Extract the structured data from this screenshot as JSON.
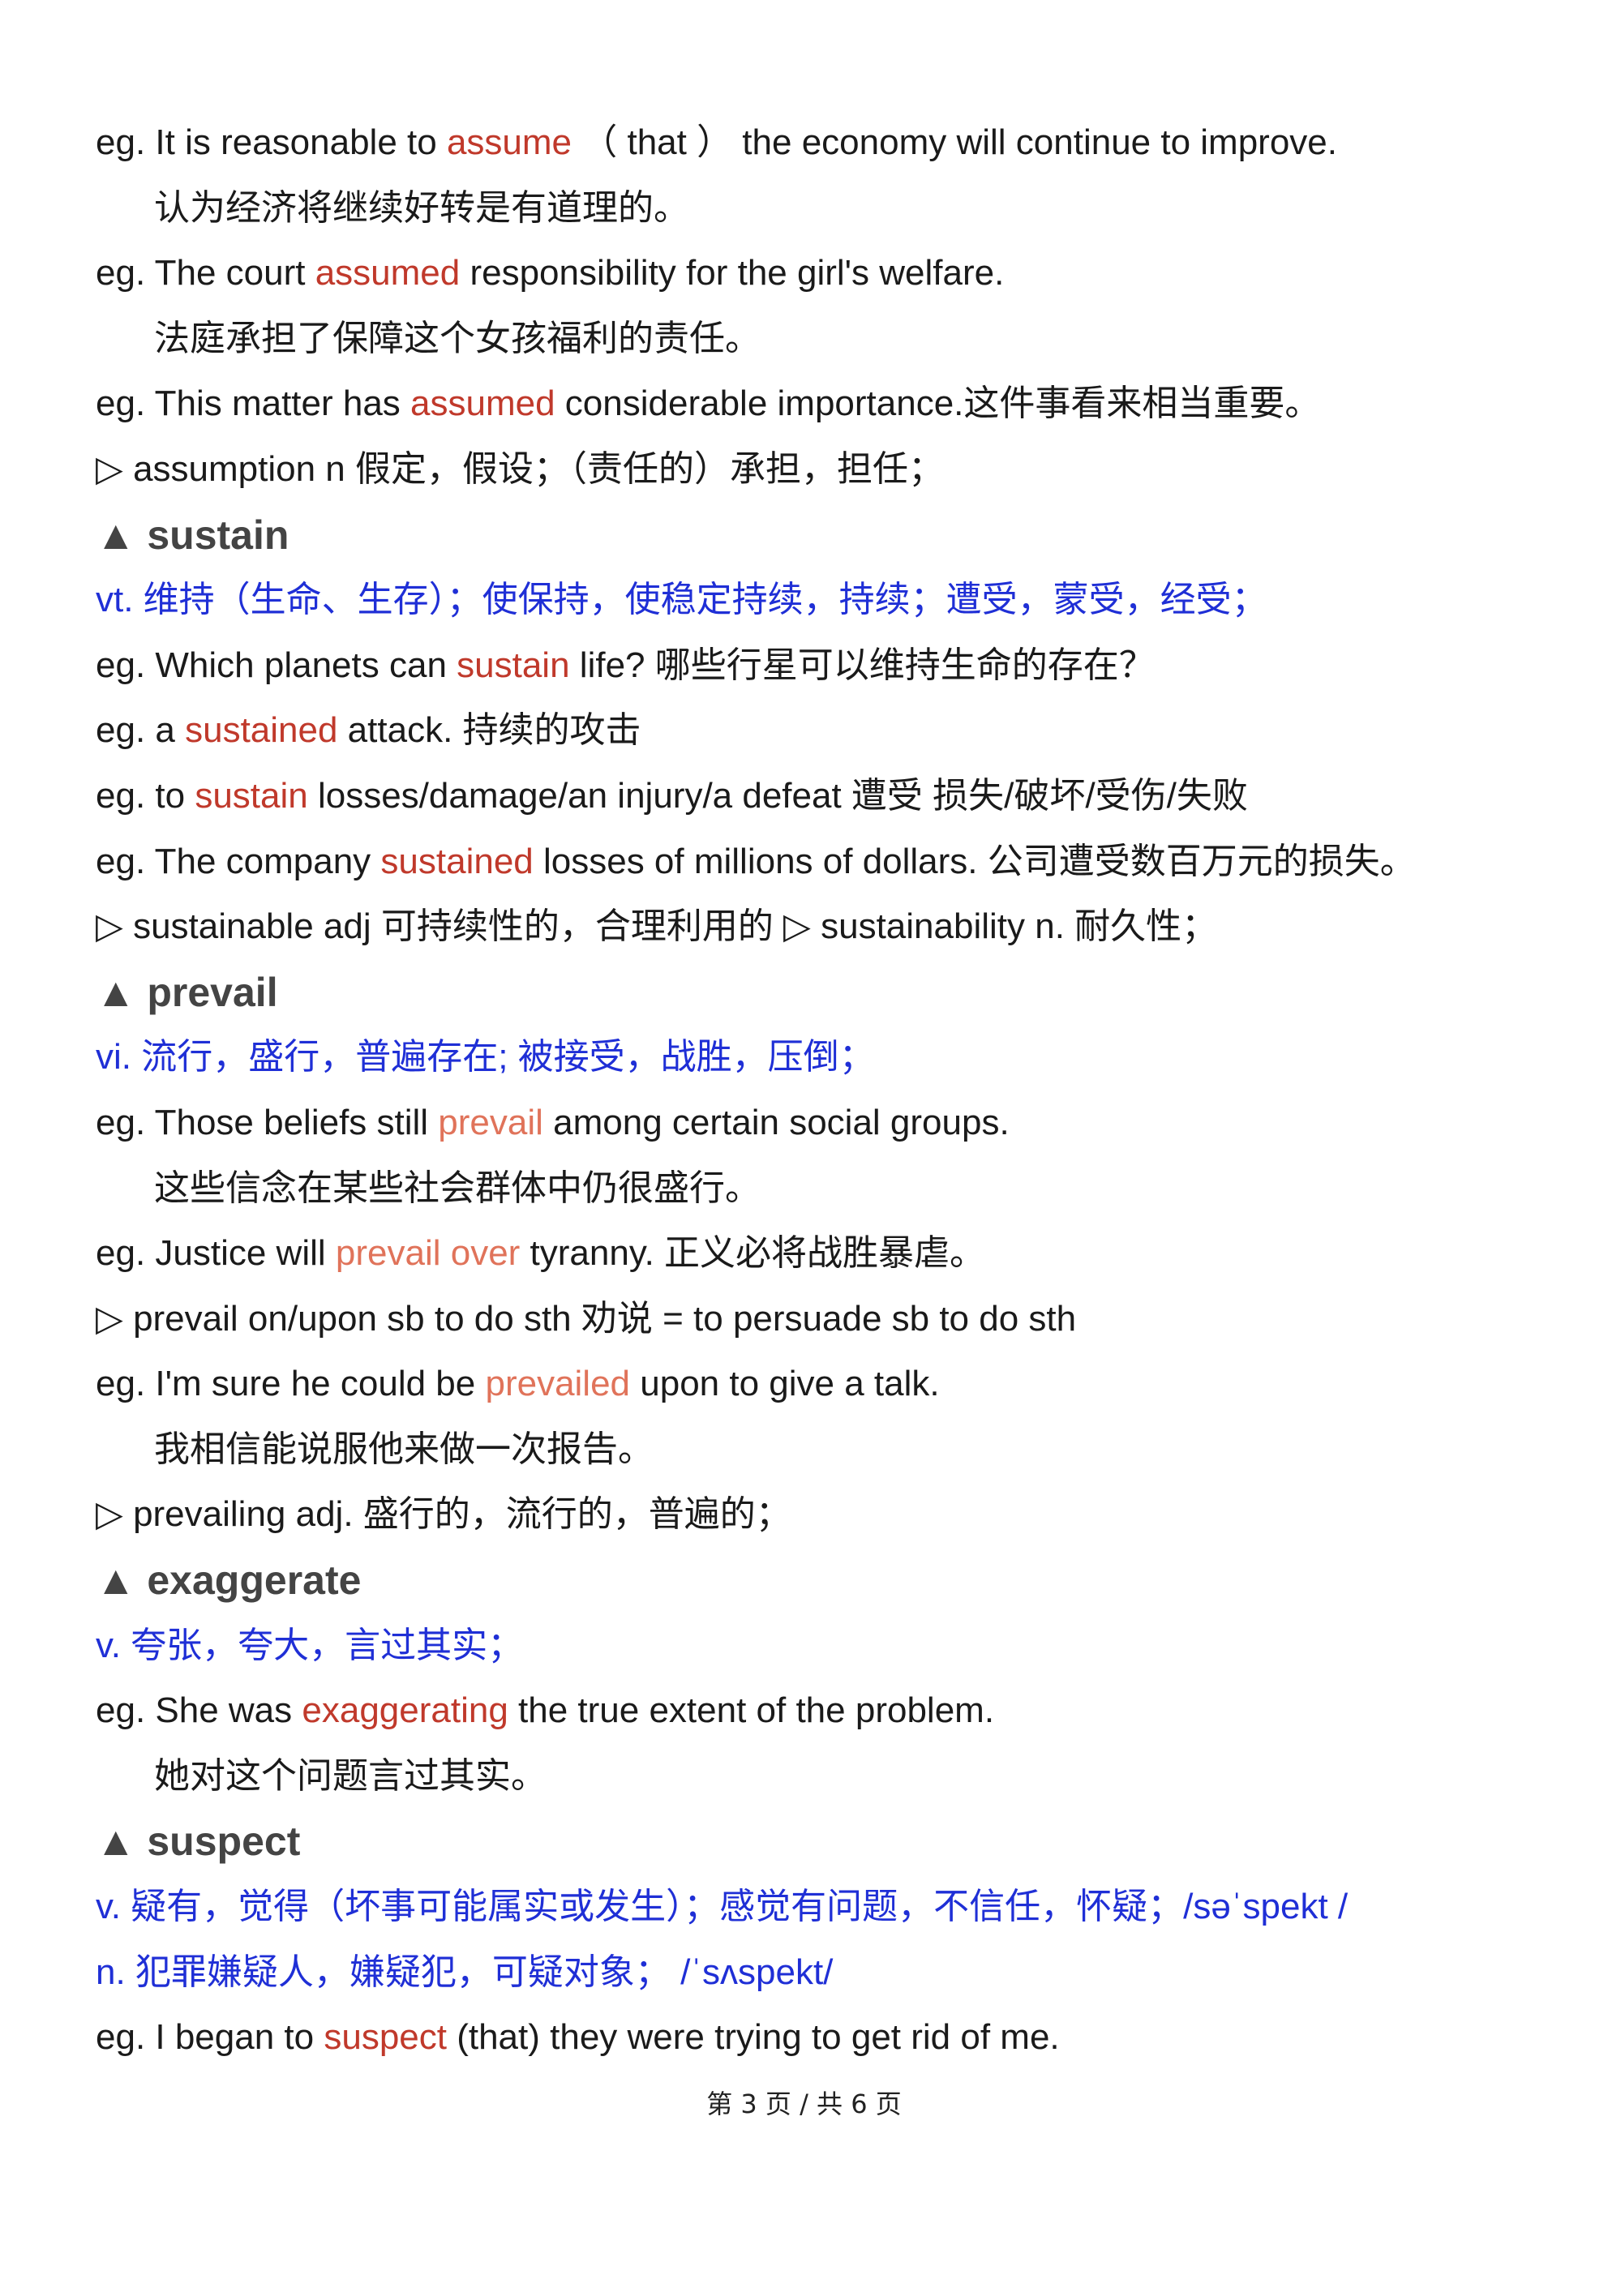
{
  "lines": [
    {
      "type": "example",
      "parts": [
        {
          "t": "eg. It is reasonable to "
        },
        {
          "t": "assume",
          "c": "hl"
        },
        {
          "t": "  （ that ）  the economy will continue to improve."
        }
      ]
    },
    {
      "type": "translation",
      "parts": [
        {
          "t": "认为经济将继续好转是有道理的。"
        }
      ]
    },
    {
      "type": "example",
      "parts": [
        {
          "t": "eg. The court "
        },
        {
          "t": "assumed",
          "c": "hl"
        },
        {
          "t": " responsibility for the girl's welfare."
        }
      ]
    },
    {
      "type": "translation",
      "parts": [
        {
          "t": "法庭承担了保障这个女孩福利的责任。"
        }
      ]
    },
    {
      "type": "example",
      "parts": [
        {
          "t": "eg. This matter has "
        },
        {
          "t": "assumed",
          "c": "hl"
        },
        {
          "t": " considerable importance.这件事看来相当重要。"
        }
      ]
    },
    {
      "type": "derivative",
      "parts": [
        {
          "t": "▷ assumption n  假定，假设；（责任的）承担，担任；"
        }
      ]
    },
    {
      "type": "headword",
      "parts": [
        {
          "t": "▲ sustain"
        }
      ]
    },
    {
      "type": "definition",
      "parts": [
        {
          "t": "vt.  维持（生命、生存）；使保持，使稳定持续，持续；遭受，蒙受，经受；"
        }
      ]
    },
    {
      "type": "example",
      "parts": [
        {
          "t": "eg. Which planets can "
        },
        {
          "t": "sustain",
          "c": "hl"
        },
        {
          "t": " life?  哪些行星可以维持生命的存在？"
        }
      ]
    },
    {
      "type": "example",
      "parts": [
        {
          "t": "eg. a "
        },
        {
          "t": "sustained",
          "c": "hl"
        },
        {
          "t": " attack.  持续的攻击"
        }
      ]
    },
    {
      "type": "example",
      "parts": [
        {
          "t": "eg. to "
        },
        {
          "t": "sustain",
          "c": "hl"
        },
        {
          "t": " losses/damage/an injury/a defeat 遭受  损失/破坏/受伤/失败"
        }
      ]
    },
    {
      "type": "example",
      "parts": [
        {
          "t": "eg. The company "
        },
        {
          "t": "sustained",
          "c": "hl"
        },
        {
          "t": " losses of millions of dollars.  公司遭受数百万元的损失。"
        }
      ]
    },
    {
      "type": "derivative",
      "parts": [
        {
          "t": "▷ sustainable adj  可持续性的，合理利用的  ▷ sustainability n.  耐久性；"
        }
      ]
    },
    {
      "type": "headword",
      "parts": [
        {
          "t": "▲ prevail"
        }
      ]
    },
    {
      "type": "definition",
      "parts": [
        {
          "t": "vi.  流行，盛行，普遍存在; 被接受，战胜，压倒；"
        }
      ]
    },
    {
      "type": "example",
      "parts": [
        {
          "t": "eg. Those beliefs still "
        },
        {
          "t": "prevail",
          "c": "hl-light"
        },
        {
          "t": " among certain social groups."
        }
      ]
    },
    {
      "type": "translation",
      "parts": [
        {
          "t": "这些信念在某些社会群体中仍很盛行。"
        }
      ]
    },
    {
      "type": "example",
      "parts": [
        {
          "t": "eg. Justice will "
        },
        {
          "t": "prevail over",
          "c": "hl-light"
        },
        {
          "t": " tyranny.  正义必将战胜暴虐。"
        }
      ]
    },
    {
      "type": "derivative",
      "parts": [
        {
          "t": "▷ prevail on/upon sb to do sth  劝说   = to persuade sb to do sth"
        }
      ]
    },
    {
      "type": "example",
      "parts": [
        {
          "t": "eg. I'm sure he could be "
        },
        {
          "t": "prevailed",
          "c": "hl-light"
        },
        {
          "t": " upon to give a talk."
        }
      ]
    },
    {
      "type": "translation",
      "parts": [
        {
          "t": "我相信能说服他来做一次报告。"
        }
      ]
    },
    {
      "type": "derivative",
      "parts": [
        {
          "t": "▷ prevailing adj.  盛行的，流行的，普遍的；"
        }
      ]
    },
    {
      "type": "headword",
      "parts": [
        {
          "t": "▲ exaggerate"
        }
      ]
    },
    {
      "type": "definition",
      "parts": [
        {
          "t": "v.  夸张，夸大，言过其实；"
        }
      ]
    },
    {
      "type": "example",
      "parts": [
        {
          "t": "eg. She was "
        },
        {
          "t": "exaggerating",
          "c": "hl"
        },
        {
          "t": " the true extent of the problem."
        }
      ]
    },
    {
      "type": "translation",
      "parts": [
        {
          "t": "她对这个问题言过其实。"
        }
      ]
    },
    {
      "type": "headword",
      "parts": [
        {
          "t": "▲ suspect"
        }
      ]
    },
    {
      "type": "definition",
      "parts": [
        {
          "t": "v.  疑有，觉得（坏事可能属实或发生）；感觉有问题，不信任，怀疑；/səˈspekt /"
        }
      ]
    },
    {
      "type": "definition",
      "parts": [
        {
          "t": "n.  犯罪嫌疑人，嫌疑犯，可疑对象；  /ˈsʌspekt/"
        }
      ]
    },
    {
      "type": "example",
      "parts": [
        {
          "t": "eg. I began to "
        },
        {
          "t": "suspect",
          "c": "hl"
        },
        {
          "t": " (that) they were trying to get rid of me."
        }
      ]
    }
  ],
  "footer": {
    "label": "第 3 页 / 共 6 页"
  }
}
